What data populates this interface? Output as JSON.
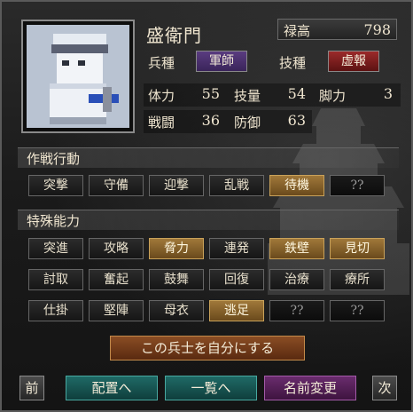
{
  "header": {
    "name": "盛衛門",
    "salary_label": "禄高",
    "salary_value": "798"
  },
  "unit": {
    "troop_label": "兵種",
    "troop_value": "軍師",
    "skill_label": "技種",
    "skill_value": "虚報"
  },
  "stats": {
    "hp_label": "体力",
    "hp_value": "55",
    "tech_label": "技量",
    "tech_value": "54",
    "leg_label": "脚力",
    "leg_value": "3",
    "atk_label": "戦闘",
    "atk_value": "36",
    "def_label": "防御",
    "def_value": "63"
  },
  "tactics": {
    "title": "作戦行動",
    "items": [
      "突撃",
      "守備",
      "迎撃",
      "乱戦",
      "待機",
      "??"
    ]
  },
  "abilities": {
    "title": "特殊能力",
    "row1": [
      "突進",
      "攻略",
      "脅力",
      "連発",
      "鉄壁",
      "見切"
    ],
    "row2": [
      "討取",
      "奮起",
      "鼓舞",
      "回復",
      "治療",
      "療所"
    ],
    "row3": [
      "仕掛",
      "堅陣",
      "母衣",
      "逃足",
      "??",
      "??"
    ]
  },
  "actions": {
    "make_own": "この兵士を自分にする",
    "prev": "前",
    "deploy": "配置へ",
    "list": "一覧へ",
    "rename": "名前変更",
    "next": "次"
  },
  "colors": {
    "active_gold": "#a0783a",
    "teal": "#1f6a66",
    "purple": "#6a2c6e",
    "red": "#9b2a2a"
  }
}
